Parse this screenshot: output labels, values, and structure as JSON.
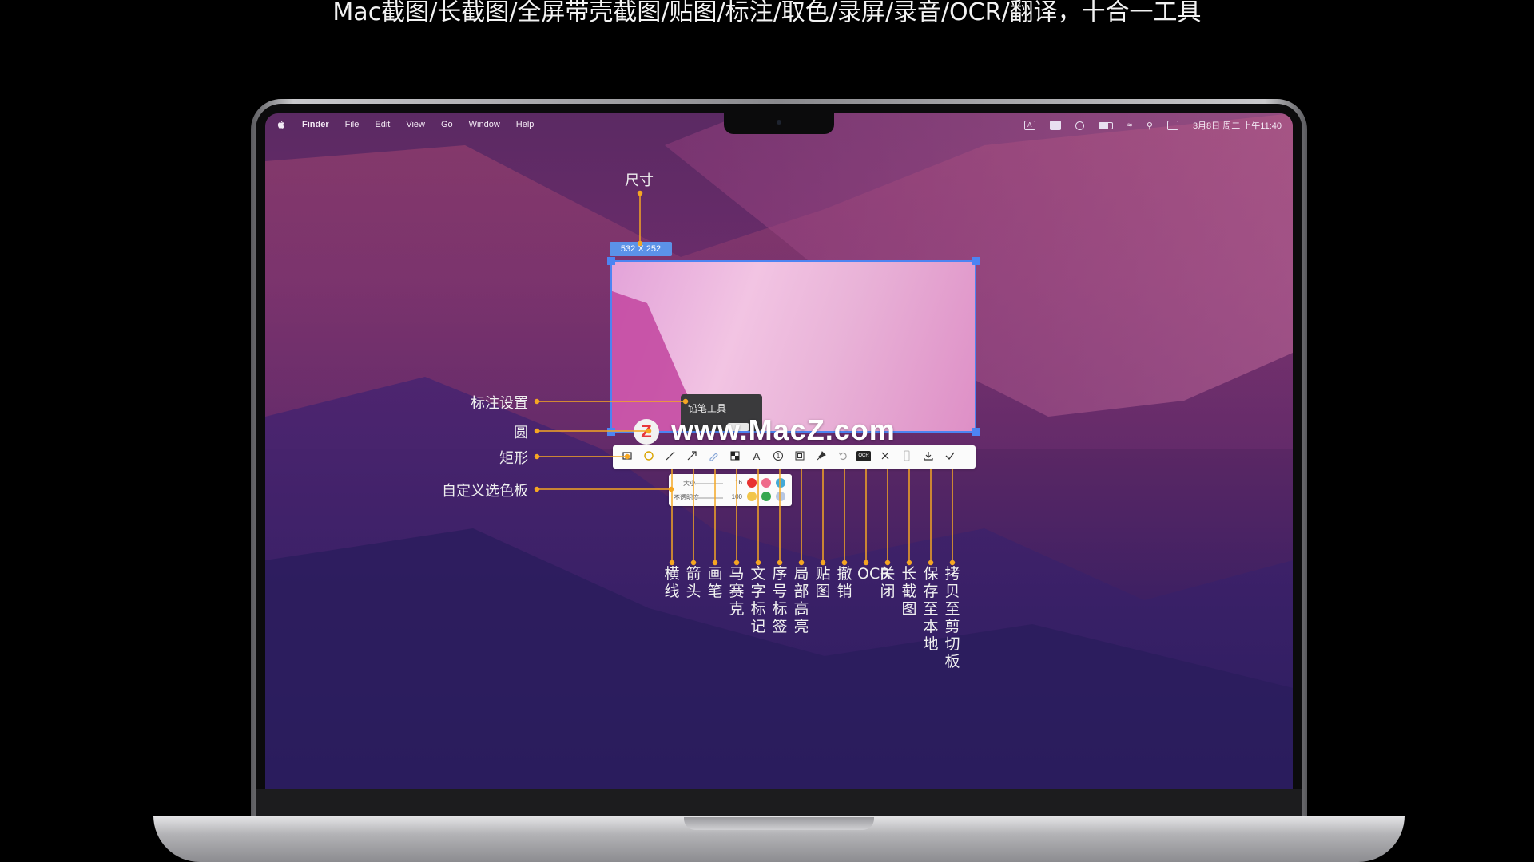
{
  "headline": "Mac截图/长截图/全屏带壳截图/贴图/标注/取色/录屏/录音/OCR/翻译，十合一工具",
  "menubar": {
    "app": "Finder",
    "items": [
      "File",
      "Edit",
      "View",
      "Go",
      "Window",
      "Help"
    ],
    "status_icons": [
      "input-source-icon",
      "photo-icon",
      "user-icon",
      "battery-icon",
      "wifi-icon",
      "search-icon",
      "control-center-icon"
    ],
    "input_source": "A",
    "datetime": "3月8日 周二 上午11:40"
  },
  "selection": {
    "size_label": "532  X  252"
  },
  "tooltip": {
    "label": "铅笔工具"
  },
  "watermark": {
    "logo": "Z",
    "text": "www.MacZ.com"
  },
  "toolbar_icons": [
    "rectangle-icon",
    "circle-icon",
    "line-icon",
    "arrow-icon",
    "pencil-icon",
    "mosaic-icon",
    "text-icon",
    "number-tag-icon",
    "highlight-icon",
    "pin-icon",
    "undo-icon",
    "ocr-icon",
    "close-icon",
    "long-screenshot-icon",
    "save-icon",
    "copy-check-icon"
  ],
  "palette": {
    "size_label": "大小",
    "size_value": "16",
    "opacity_label": "不透明度",
    "opacity_value": "100",
    "colors": [
      "#e8322f",
      "#ef6a8a",
      "#43a9d8",
      "#f2c64a",
      "#36a850",
      "#b7c7e2"
    ]
  },
  "annotations": {
    "size": "尺寸",
    "settings": "标注设置",
    "circle": "圆",
    "rect": "矩形",
    "custom_palette": "自定义选色板",
    "bottom": [
      "横线",
      "箭头",
      "画笔",
      "马赛克",
      "文字标记",
      "序号标签",
      "局部高亮",
      "贴图",
      "撤销",
      "OCR",
      "关闭",
      "长截图",
      "保存至本地",
      "拷贝至剪切板"
    ]
  },
  "colors": {
    "accent_line": "#f5a623",
    "selection_border": "#4d84f2"
  }
}
